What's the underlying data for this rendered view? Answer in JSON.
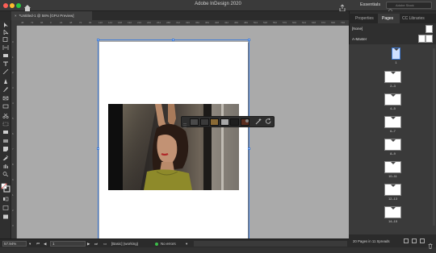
{
  "titlebar": {
    "title": "Adobe InDesign 2020",
    "workspace": "Essentials",
    "search_placeholder": "Adobe Stock"
  },
  "document_tab": {
    "close": "×",
    "label": "*Untitled-1 @ 58% [GPU Preview]"
  },
  "ruler": {
    "h_ticks": [
      "48",
      "72",
      "96",
      "0",
      "24",
      "48",
      "72",
      "96",
      "120",
      "144",
      "168",
      "192",
      "216",
      "240",
      "264",
      "288",
      "312",
      "336",
      "360",
      "384",
      "408",
      "432",
      "456",
      "480",
      "504",
      "528",
      "552",
      "576",
      "600",
      "624",
      "648",
      "672",
      "696",
      "720"
    ],
    "v_ticks": [
      "0",
      "1",
      "2",
      "3",
      "4",
      "5",
      "6",
      "7",
      "8",
      "9",
      "1",
      "2",
      "3"
    ]
  },
  "context_bar": {
    "swatches": [
      "#4a4a4a",
      "#3a3a3a",
      "#8a6a35",
      "#a8a8a8",
      "#1e1e1e",
      "#5a2e20"
    ],
    "accent": "#3f7bd6"
  },
  "status": {
    "zoom": "57.94%",
    "page": "1",
    "profile": "[Basic] (working)",
    "errors": "No errors"
  },
  "panel": {
    "tabs": [
      "Properties",
      "Pages",
      "CC Libraries"
    ],
    "active_tab": "Pages",
    "none_label": "[None]",
    "master_label": "A-Master",
    "page_labels": [
      "1",
      "2–3",
      "4–5",
      "6–7",
      "8–9",
      "10–11",
      "12–13",
      "14–15"
    ],
    "footer": "20 Pages in 11 Spreads"
  }
}
